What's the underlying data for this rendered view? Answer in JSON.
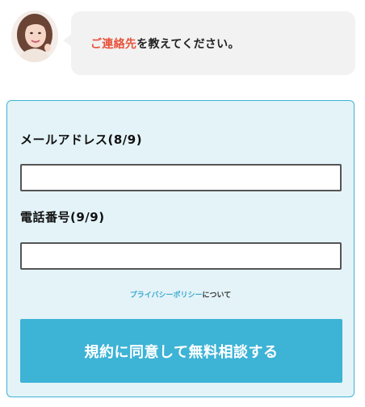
{
  "header": {
    "avatar_icon": "operator-avatar-icon",
    "message_accent": "ご連絡先",
    "message_rest": "を教えてください。"
  },
  "form": {
    "email": {
      "label": "メールアドレス(8/9)",
      "value": ""
    },
    "phone": {
      "label": "電話番号(9/9)",
      "value": ""
    },
    "privacy": {
      "link_text": "プライバシーポリシー",
      "suffix": "について"
    },
    "submit_label": "規約に同意して無料相談する"
  },
  "colors": {
    "accent_text": "#e8533b",
    "panel_background": "#e4f3f8",
    "panel_border": "#3fb4d3",
    "submit_background": "#3db3d6",
    "link": "#3aa9cf",
    "bubble_background": "#f2f2f2"
  }
}
